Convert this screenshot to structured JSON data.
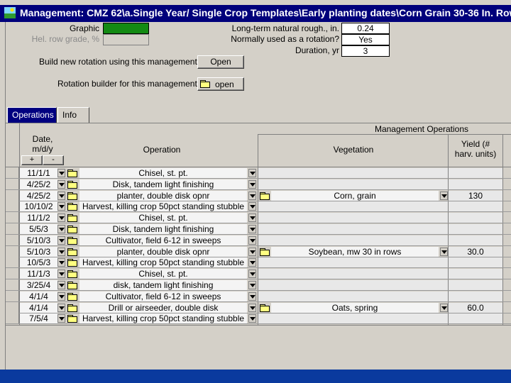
{
  "window": {
    "title": "Management:  CMZ 62\\a.Single Year/ Single Crop Templates\\Early planting dates\\Corn Grain 30-36 In. Row"
  },
  "top_panel": {
    "graphic_label": "Graphic",
    "graphic_color": "#138a13",
    "hel_label": "Hel. row grade, %",
    "roughness_label": "Long-term natural rough., in.",
    "roughness_value": "0.24",
    "rotation_label": "Normally used as a rotation?",
    "rotation_value": "Yes",
    "duration_label": "Duration, yr",
    "duration_value": "3",
    "build_label": "Build new rotation using this management",
    "build_button": "Open",
    "builder_label": "Rotation builder for this management",
    "builder_button": "open"
  },
  "tabs": [
    {
      "label": "Operations"
    },
    {
      "label": "Info"
    }
  ],
  "grid": {
    "group_header": "Management Operations",
    "col_date": "Date,\nm/d/y",
    "date_plus": "+",
    "date_minus": "-",
    "col_operation": "Operation",
    "col_vegetation": "Vegetation",
    "col_yield": "Yield (#\nharv. units)",
    "rows": [
      {
        "date": "11/1/1",
        "operation": "Chisel, st. pt.",
        "vegetation": "",
        "yield": ""
      },
      {
        "date": "4/25/2",
        "operation": "Disk, tandem light finishing",
        "vegetation": "",
        "yield": ""
      },
      {
        "date": "4/25/2",
        "operation": "planter, double disk opnr",
        "vegetation": "Corn, grain",
        "yield": "130"
      },
      {
        "date": "10/10/2",
        "operation": "Harvest, killing crop 50pct standing stubble",
        "vegetation": "",
        "yield": ""
      },
      {
        "date": "11/1/2",
        "operation": "Chisel, st. pt.",
        "vegetation": "",
        "yield": ""
      },
      {
        "date": "5/5/3",
        "operation": "Disk, tandem light finishing",
        "vegetation": "",
        "yield": ""
      },
      {
        "date": "5/10/3",
        "operation": "Cultivator, field 6-12 in sweeps",
        "vegetation": "",
        "yield": ""
      },
      {
        "date": "5/10/3",
        "operation": "planter, double disk opnr",
        "vegetation": "Soybean, mw 30 in rows",
        "yield": "30.0"
      },
      {
        "date": "10/5/3",
        "operation": "Harvest, killing crop 50pct standing stubble",
        "vegetation": "",
        "yield": ""
      },
      {
        "date": "11/1/3",
        "operation": "Chisel, st. pt.",
        "vegetation": "",
        "yield": ""
      },
      {
        "date": "3/25/4",
        "operation": "disk, tandem light finishing",
        "vegetation": "",
        "yield": ""
      },
      {
        "date": "4/1/4",
        "operation": "Cultivator, field 6-12 in sweeps",
        "vegetation": "",
        "yield": ""
      },
      {
        "date": "4/1/4",
        "operation": "Drill or airseeder, double disk",
        "vegetation": "Oats, spring",
        "yield": "60.0"
      },
      {
        "date": "7/5/4",
        "operation": "Harvest, killing crop 50pct standing stubble",
        "vegetation": "",
        "yield": ""
      }
    ]
  },
  "colors": {
    "titlebar": "#00007b",
    "taskbar": "#0a3a9e",
    "active_tab": "#000080"
  }
}
